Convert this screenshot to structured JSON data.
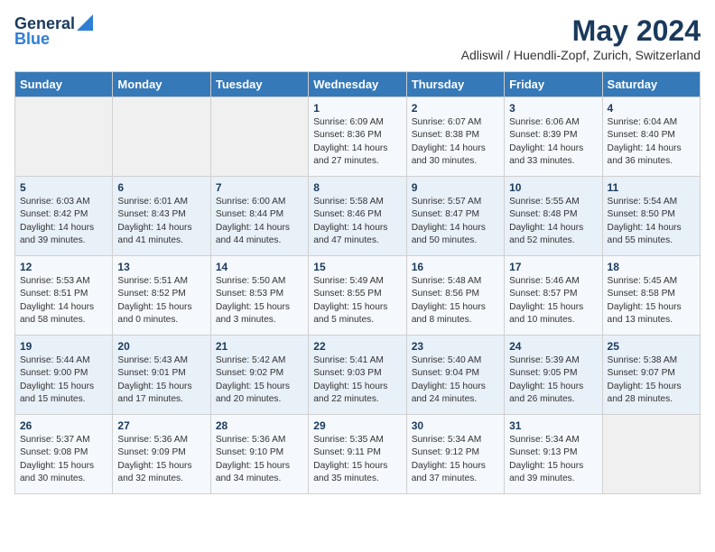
{
  "header": {
    "logo_general": "General",
    "logo_blue": "Blue",
    "month": "May 2024",
    "location": "Adliswil / Huendli-Zopf, Zurich, Switzerland"
  },
  "weekdays": [
    "Sunday",
    "Monday",
    "Tuesday",
    "Wednesday",
    "Thursday",
    "Friday",
    "Saturday"
  ],
  "weeks": [
    [
      {
        "day": "",
        "content": ""
      },
      {
        "day": "",
        "content": ""
      },
      {
        "day": "",
        "content": ""
      },
      {
        "day": "1",
        "content": "Sunrise: 6:09 AM\nSunset: 8:36 PM\nDaylight: 14 hours\nand 27 minutes."
      },
      {
        "day": "2",
        "content": "Sunrise: 6:07 AM\nSunset: 8:38 PM\nDaylight: 14 hours\nand 30 minutes."
      },
      {
        "day": "3",
        "content": "Sunrise: 6:06 AM\nSunset: 8:39 PM\nDaylight: 14 hours\nand 33 minutes."
      },
      {
        "day": "4",
        "content": "Sunrise: 6:04 AM\nSunset: 8:40 PM\nDaylight: 14 hours\nand 36 minutes."
      }
    ],
    [
      {
        "day": "5",
        "content": "Sunrise: 6:03 AM\nSunset: 8:42 PM\nDaylight: 14 hours\nand 39 minutes."
      },
      {
        "day": "6",
        "content": "Sunrise: 6:01 AM\nSunset: 8:43 PM\nDaylight: 14 hours\nand 41 minutes."
      },
      {
        "day": "7",
        "content": "Sunrise: 6:00 AM\nSunset: 8:44 PM\nDaylight: 14 hours\nand 44 minutes."
      },
      {
        "day": "8",
        "content": "Sunrise: 5:58 AM\nSunset: 8:46 PM\nDaylight: 14 hours\nand 47 minutes."
      },
      {
        "day": "9",
        "content": "Sunrise: 5:57 AM\nSunset: 8:47 PM\nDaylight: 14 hours\nand 50 minutes."
      },
      {
        "day": "10",
        "content": "Sunrise: 5:55 AM\nSunset: 8:48 PM\nDaylight: 14 hours\nand 52 minutes."
      },
      {
        "day": "11",
        "content": "Sunrise: 5:54 AM\nSunset: 8:50 PM\nDaylight: 14 hours\nand 55 minutes."
      }
    ],
    [
      {
        "day": "12",
        "content": "Sunrise: 5:53 AM\nSunset: 8:51 PM\nDaylight: 14 hours\nand 58 minutes."
      },
      {
        "day": "13",
        "content": "Sunrise: 5:51 AM\nSunset: 8:52 PM\nDaylight: 15 hours\nand 0 minutes."
      },
      {
        "day": "14",
        "content": "Sunrise: 5:50 AM\nSunset: 8:53 PM\nDaylight: 15 hours\nand 3 minutes."
      },
      {
        "day": "15",
        "content": "Sunrise: 5:49 AM\nSunset: 8:55 PM\nDaylight: 15 hours\nand 5 minutes."
      },
      {
        "day": "16",
        "content": "Sunrise: 5:48 AM\nSunset: 8:56 PM\nDaylight: 15 hours\nand 8 minutes."
      },
      {
        "day": "17",
        "content": "Sunrise: 5:46 AM\nSunset: 8:57 PM\nDaylight: 15 hours\nand 10 minutes."
      },
      {
        "day": "18",
        "content": "Sunrise: 5:45 AM\nSunset: 8:58 PM\nDaylight: 15 hours\nand 13 minutes."
      }
    ],
    [
      {
        "day": "19",
        "content": "Sunrise: 5:44 AM\nSunset: 9:00 PM\nDaylight: 15 hours\nand 15 minutes."
      },
      {
        "day": "20",
        "content": "Sunrise: 5:43 AM\nSunset: 9:01 PM\nDaylight: 15 hours\nand 17 minutes."
      },
      {
        "day": "21",
        "content": "Sunrise: 5:42 AM\nSunset: 9:02 PM\nDaylight: 15 hours\nand 20 minutes."
      },
      {
        "day": "22",
        "content": "Sunrise: 5:41 AM\nSunset: 9:03 PM\nDaylight: 15 hours\nand 22 minutes."
      },
      {
        "day": "23",
        "content": "Sunrise: 5:40 AM\nSunset: 9:04 PM\nDaylight: 15 hours\nand 24 minutes."
      },
      {
        "day": "24",
        "content": "Sunrise: 5:39 AM\nSunset: 9:05 PM\nDaylight: 15 hours\nand 26 minutes."
      },
      {
        "day": "25",
        "content": "Sunrise: 5:38 AM\nSunset: 9:07 PM\nDaylight: 15 hours\nand 28 minutes."
      }
    ],
    [
      {
        "day": "26",
        "content": "Sunrise: 5:37 AM\nSunset: 9:08 PM\nDaylight: 15 hours\nand 30 minutes."
      },
      {
        "day": "27",
        "content": "Sunrise: 5:36 AM\nSunset: 9:09 PM\nDaylight: 15 hours\nand 32 minutes."
      },
      {
        "day": "28",
        "content": "Sunrise: 5:36 AM\nSunset: 9:10 PM\nDaylight: 15 hours\nand 34 minutes."
      },
      {
        "day": "29",
        "content": "Sunrise: 5:35 AM\nSunset: 9:11 PM\nDaylight: 15 hours\nand 35 minutes."
      },
      {
        "day": "30",
        "content": "Sunrise: 5:34 AM\nSunset: 9:12 PM\nDaylight: 15 hours\nand 37 minutes."
      },
      {
        "day": "31",
        "content": "Sunrise: 5:34 AM\nSunset: 9:13 PM\nDaylight: 15 hours\nand 39 minutes."
      },
      {
        "day": "",
        "content": ""
      }
    ]
  ]
}
